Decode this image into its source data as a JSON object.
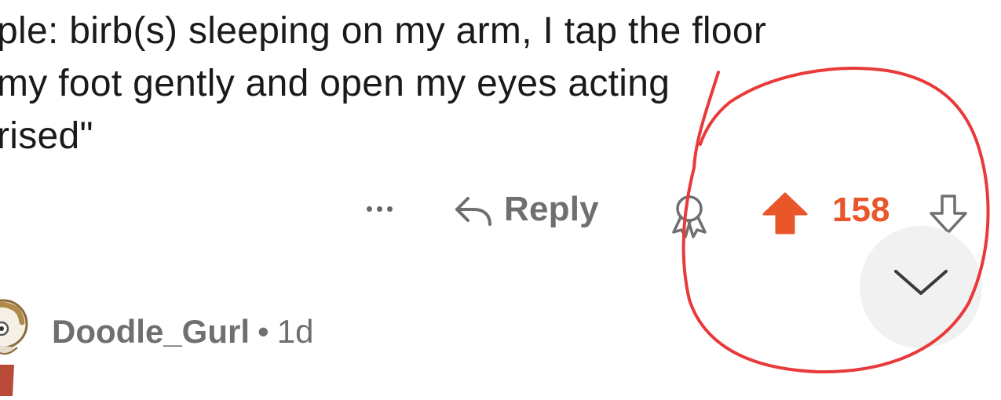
{
  "comment": {
    "lines": [
      "ple: birb(s) sleeping on my arm, I tap the floor",
      "my foot gently and open my eyes acting",
      "rised\""
    ]
  },
  "actions": {
    "more_icon": "more-horizontal-icon",
    "reply_icon": "reply-arrow-icon",
    "reply_label": "Reply",
    "award_icon": "award-icon",
    "upvote_icon": "upvote-arrow-icon",
    "score": "158",
    "downvote_icon": "downvote-arrow-icon",
    "upvoted": true,
    "accent_color": "#e8562a"
  },
  "collapse": {
    "icon": "chevron-down-icon"
  },
  "next_comment": {
    "username": "Doodle_Gurl",
    "separator": "•",
    "age": "1d"
  },
  "annotation": {
    "shape": "hand-drawn circle",
    "color": "#e83a3a"
  }
}
